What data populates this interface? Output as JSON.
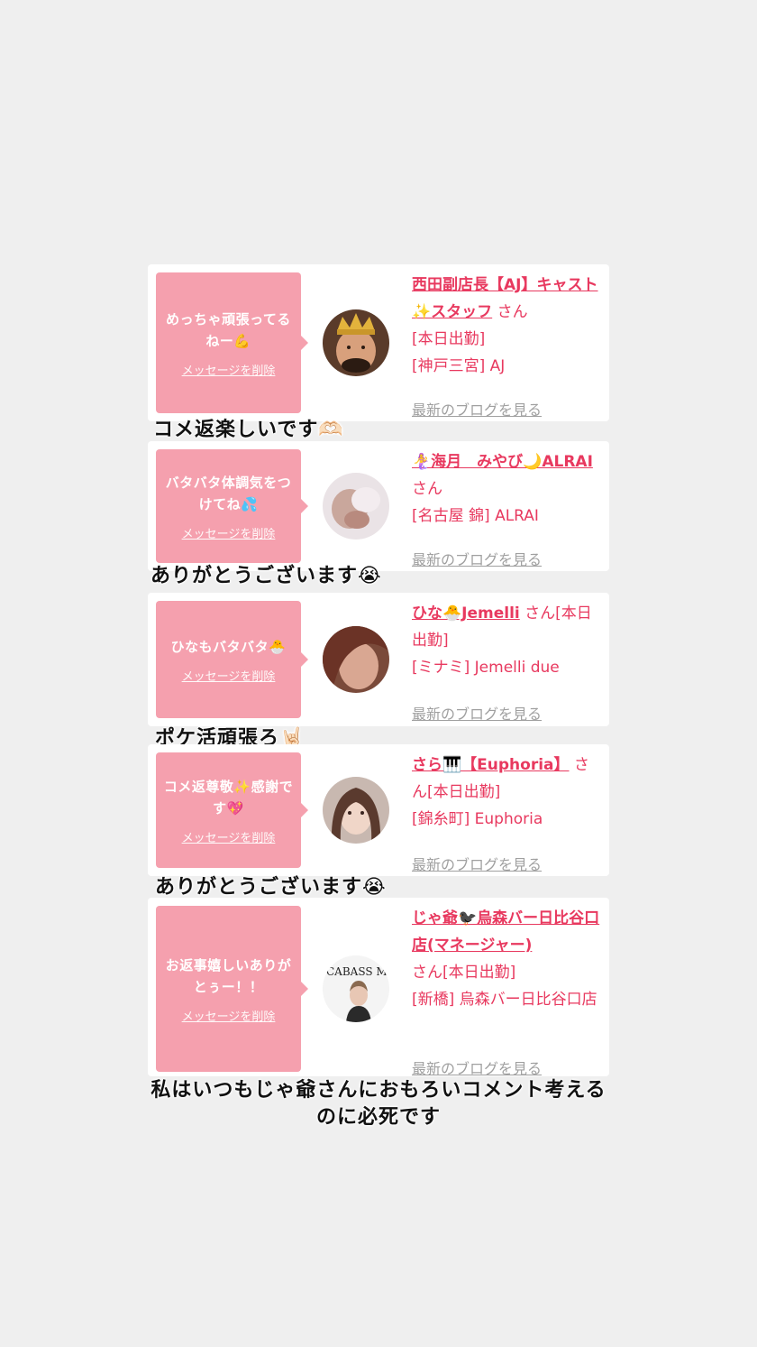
{
  "messages": [
    {
      "bubble_text": "めっちゃ頑張ってるねー💪",
      "delete_label": "メッセージを削除",
      "name": "西田副店長【AJ】キャスト✨スタッフ",
      "honorific": "さん",
      "line2": "[本日出勤]",
      "line3": "[神戸三宮] AJ",
      "line4": "",
      "blog_label": "最新のブログを見る",
      "caption": "コメ返楽しいです🫶🏻"
    },
    {
      "bubble_text": "バタバタ体調気をつけてね💦",
      "delete_label": "メッセージを削除",
      "name": "🧜‍♀️海月　みやび🌙ALRAI",
      "honorific": "さん",
      "line2": "[名古屋 錦] ALRAI",
      "line3": "",
      "line4": "",
      "blog_label": "最新のブログを見る",
      "caption": "ありがとうございます😭"
    },
    {
      "bubble_text": "ひなもバタバタ🐣",
      "delete_label": "メッセージを削除",
      "name": "ひな🐣Jemelli",
      "honorific": "さん[本日出勤]",
      "line2": "[ミナミ] Jemelli due",
      "line3": "",
      "line4": "",
      "blog_label": "最新のブログを見る",
      "caption": "ポケ活頑張ろ🤘🏻"
    },
    {
      "bubble_text": "コメ返尊敬✨感謝です💖",
      "delete_label": "メッセージを削除",
      "name": "さら🎹【Euphoria】",
      "honorific": "さん[本日出勤]",
      "line2": "[錦糸町] Euphoria",
      "line3": "",
      "line4": "",
      "blog_label": "最新のブログを見る",
      "caption": "ありがとうございます😭"
    },
    {
      "bubble_text": "お返事嬉しいありがとぅー！！",
      "delete_label": "メッセージを削除",
      "name": "じゃ爺🐦‍⬛烏森バー日比谷口店(マネージャー)",
      "honorific": "さん[本日出勤]",
      "line2": "[新橋] 烏森バー日比谷口店",
      "line3": "",
      "line4": "",
      "blog_label": "最新のブログを見る",
      "caption": "私はいつもじゃ爺さんにおもろいコメント考えるのに必死です"
    }
  ],
  "avatar5_text": "CABASS MO BAR",
  "colors": {
    "background": "#efefef",
    "bubble": "#f5a0ae",
    "link": "#e8395f",
    "muted": "#a0a0a0"
  }
}
